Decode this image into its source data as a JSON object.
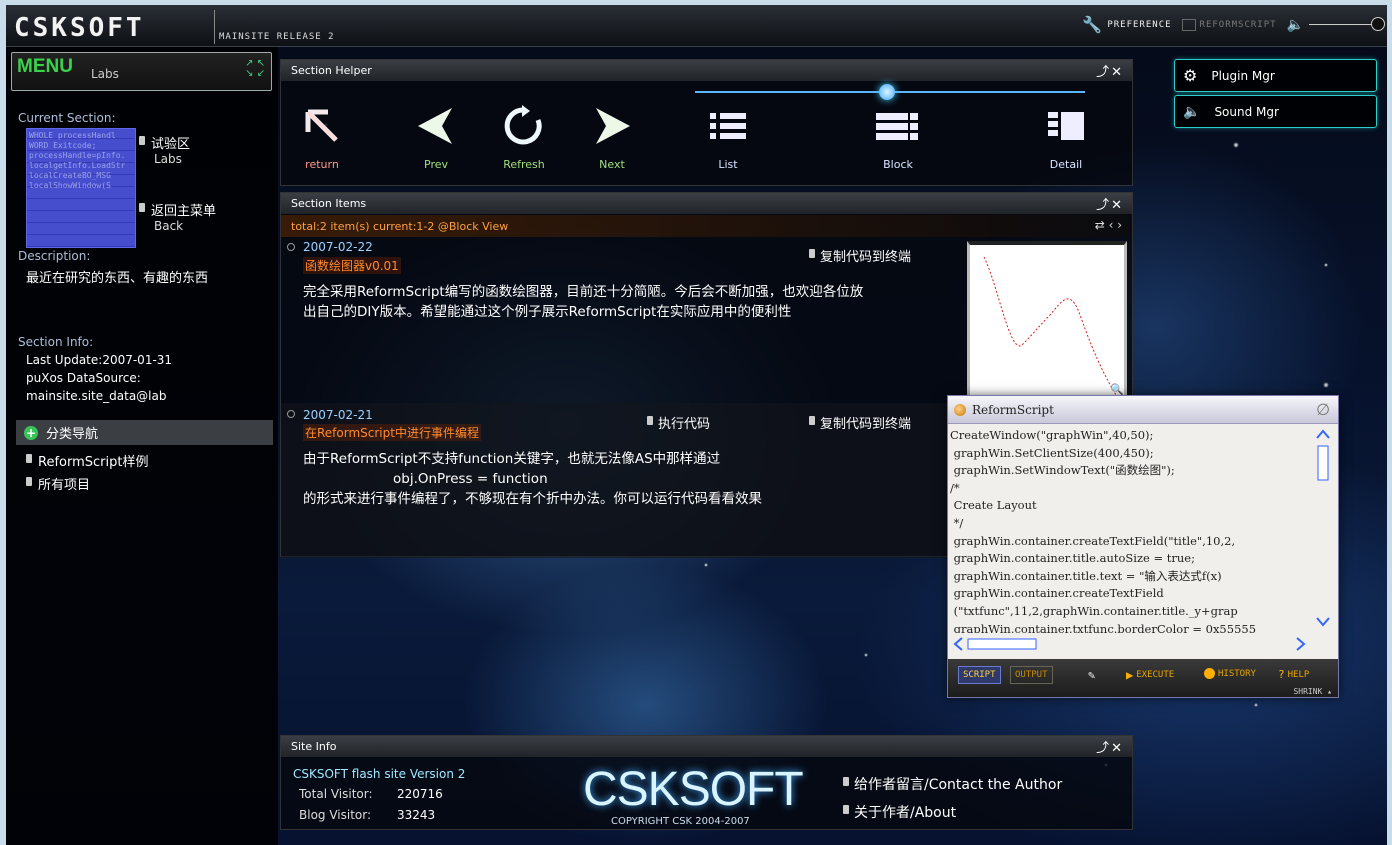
{
  "header": {
    "logo": "CSKSOFT",
    "release": "MAINSITE RELEASE 2",
    "preference": "PREFERENCE",
    "reformscript": "REFORMSCRIPT"
  },
  "menu": {
    "title": "MENU",
    "current": "Labs"
  },
  "left": {
    "current_section_label": "Current Section:",
    "thumb_text": "WHOLE processHandl\nWORD Exitcode;\nprocessHandle=pInfo.\nlocalgetInfo.LoadStr\nlocalCreateBO_MSG\nlocalShowWindow(S",
    "section_link": "试验区",
    "section_sub": "Labs",
    "back_link": "返回主菜单",
    "back_sub": "Back",
    "description_label": "Description:",
    "description": "最近在研究的东西、有趣的东西",
    "info_label": "Section Info:",
    "last_update": "Last Update:2007-01-31",
    "datasource_label": "puXos DataSource:",
    "datasource": "mainsite.site_data@lab",
    "category_nav": "分类导航",
    "categories": [
      "ReformScript样例",
      "所有项目"
    ]
  },
  "helper": {
    "title": "Section Helper",
    "buttons": {
      "return": "return",
      "prev": "Prev",
      "refresh": "Refresh",
      "next": "Next",
      "list": "List",
      "block": "Block",
      "detail": "Detail"
    }
  },
  "items_panel": {
    "title": "Section Items",
    "summary": "total:2 item(s) current:1-2 @Block View",
    "items": [
      {
        "date": "2007-02-22",
        "title": "函数绘图器v0.01",
        "copy": "复制代码到终端",
        "body1": "完全采用ReformScript编写的函数绘图器，目前还十分简陋。今后会不断加强，也欢迎各位放",
        "body2": "出自己的DIY版本。希望能通过这个例子展示ReformScript在实际应用中的便利性"
      },
      {
        "date": "2007-02-21",
        "title": "在ReformScript中进行事件编程",
        "run": "执行代码",
        "copy": "复制代码到终端",
        "body1": "由于ReformScript不支持function关键字，也就无法像AS中那样通过",
        "body2": "obj.OnPress = function",
        "body3": "的形式来进行事件编程了，不够现在有个折中办法。你可以运行代码看看效果"
      }
    ]
  },
  "reformscript": {
    "title": "ReformScript",
    "code": [
      "CreateWindow(\"graphWin\",40,50);",
      " graphWin.SetClientSize(400,450);",
      " graphWin.SetWindowText(\"函数绘图\");",
      "/*",
      " Create Layout",
      " */",
      " graphWin.container.createTextField(\"title\",10,2,",
      " graphWin.container.title.autoSize = true;",
      " graphWin.container.title.text = \"输入表达式f(x)",
      " graphWin.container.createTextField",
      " (\"txtfunc\",11,2,graphWin.container.title._y+grap",
      " graphWin.container.txtfunc.borderColor = 0x55555"
    ],
    "tab_script": "SCRIPT",
    "tab_output": "OUTPUT",
    "execute": "EXECUTE",
    "history": "HISTORY",
    "help": "HELP",
    "shrink": "SHRINK"
  },
  "right": {
    "plugin": "Plugin Mgr",
    "sound": "Sound Mgr"
  },
  "site_info": {
    "title": "Site Info",
    "version": "CSKSOFT flash site Version 2",
    "total_label": "Total Visitor:",
    "total": "220716",
    "blog_label": "Blog Visitor:",
    "blog": "33243",
    "brand": "CSKSOFT",
    "copyright": "COPYRIGHT CSK 2004-2007",
    "contact": "给作者留言/Contact the Author",
    "about": "关于作者/About"
  },
  "colors": {
    "accent_orange": "#ff8a30",
    "menu_green": "#3bd14a",
    "cyan_border": "#2ad0c8"
  }
}
